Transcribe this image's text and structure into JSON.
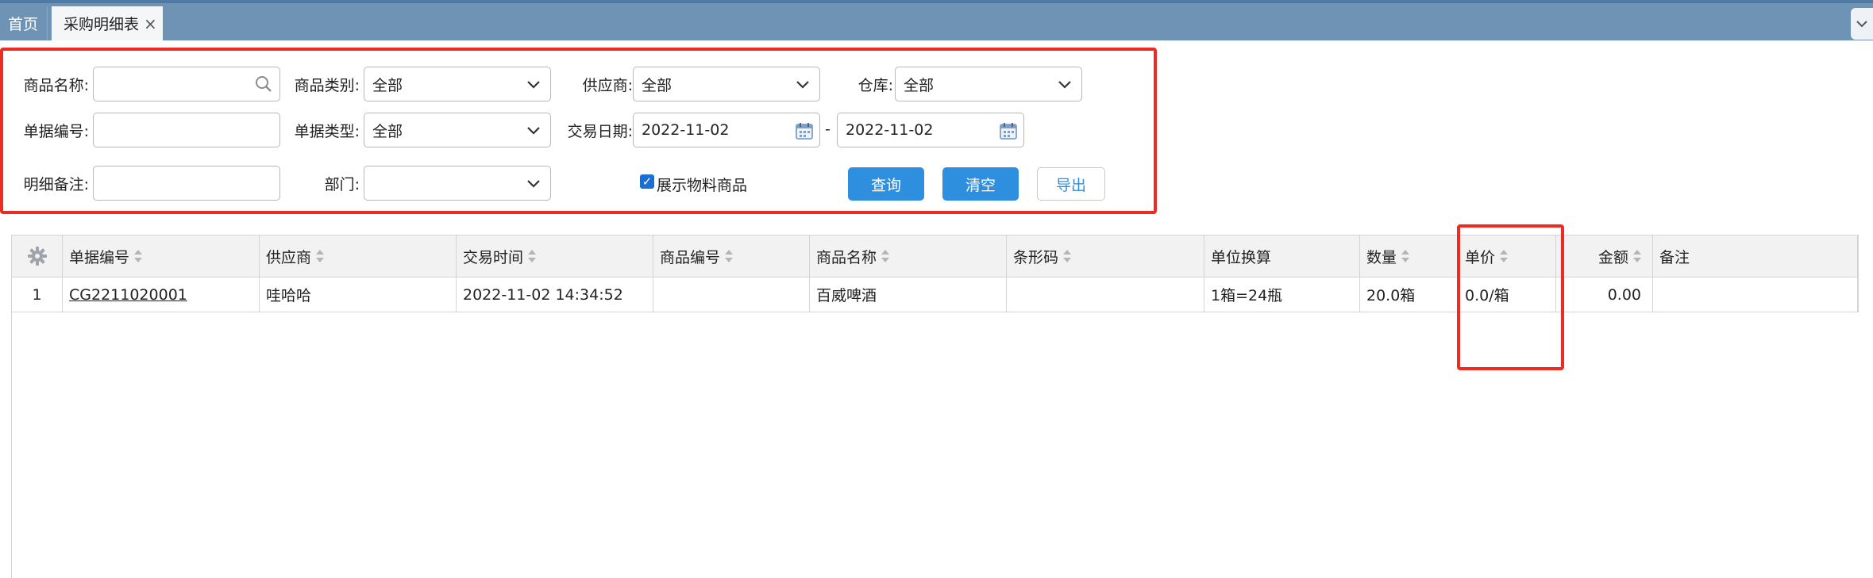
{
  "tabs": [
    {
      "label": "首页",
      "active": false
    },
    {
      "label": "采购明细表",
      "active": true
    }
  ],
  "tab_close_symbol": "×",
  "filters": {
    "product_name_label": "商品名称:",
    "product_name_value": "",
    "product_category_label": "商品类别:",
    "product_category_value": "全部",
    "supplier_label": "供应商:",
    "supplier_value": "全部",
    "warehouse_label": "仓库:",
    "warehouse_value": "全部",
    "doc_no_label": "单据编号:",
    "doc_no_value": "",
    "doc_type_label": "单据类型:",
    "doc_type_value": "全部",
    "trade_date_label": "交易日期:",
    "date_from": "2022-11-02",
    "date_separator": "-",
    "date_to": "2022-11-02",
    "detail_note_label": "明细备注:",
    "detail_note_value": "",
    "department_label": "部门:",
    "department_value": "",
    "show_material_label": "展示物料商品",
    "show_material_checked": true
  },
  "buttons": {
    "query": "查询",
    "clear": "清空",
    "export": "导出"
  },
  "table": {
    "columns": [
      "单据编号",
      "供应商",
      "交易时间",
      "商品编号",
      "商品名称",
      "条形码",
      "单位换算",
      "数量",
      "单价",
      "金额",
      "备注"
    ],
    "rows": [
      {
        "index": "1",
        "doc_no": "CG2211020001",
        "supplier": "哇哈哈",
        "trade_time": "2022-11-02 14:34:52",
        "product_code": "",
        "product_name": "百威啤酒",
        "barcode": "",
        "unit_conversion": "1箱=24瓶",
        "quantity": "20.0箱",
        "unit_price": "0.0/箱",
        "amount": "0.00",
        "note": ""
      }
    ]
  },
  "colors": {
    "tabbar": "#6f93b4",
    "primary_button": "#2f8fdf",
    "highlight_border": "#ef2a23"
  }
}
